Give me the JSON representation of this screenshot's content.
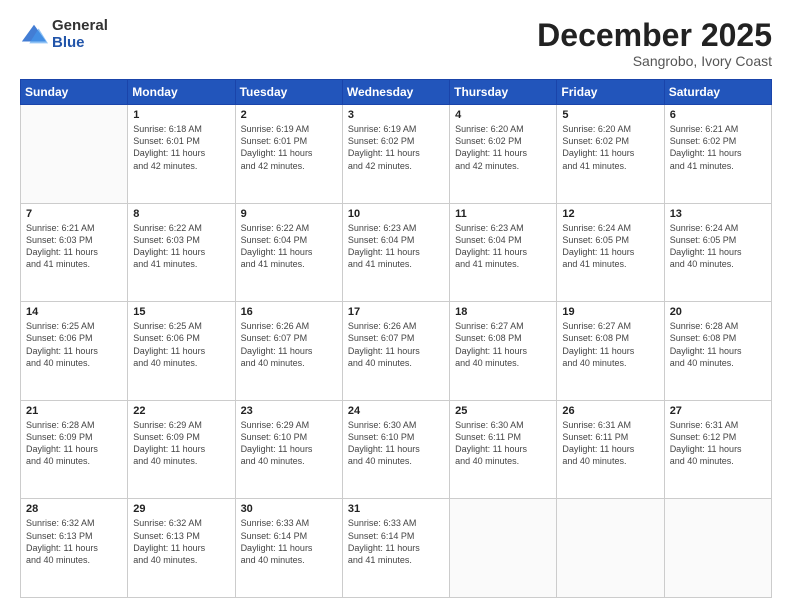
{
  "logo": {
    "general": "General",
    "blue": "Blue"
  },
  "header": {
    "month": "December 2025",
    "location": "Sangrobo, Ivory Coast"
  },
  "weekdays": [
    "Sunday",
    "Monday",
    "Tuesday",
    "Wednesday",
    "Thursday",
    "Friday",
    "Saturday"
  ],
  "weeks": [
    [
      {
        "day": "",
        "info": ""
      },
      {
        "day": "1",
        "info": "Sunrise: 6:18 AM\nSunset: 6:01 PM\nDaylight: 11 hours\nand 42 minutes."
      },
      {
        "day": "2",
        "info": "Sunrise: 6:19 AM\nSunset: 6:01 PM\nDaylight: 11 hours\nand 42 minutes."
      },
      {
        "day": "3",
        "info": "Sunrise: 6:19 AM\nSunset: 6:02 PM\nDaylight: 11 hours\nand 42 minutes."
      },
      {
        "day": "4",
        "info": "Sunrise: 6:20 AM\nSunset: 6:02 PM\nDaylight: 11 hours\nand 42 minutes."
      },
      {
        "day": "5",
        "info": "Sunrise: 6:20 AM\nSunset: 6:02 PM\nDaylight: 11 hours\nand 41 minutes."
      },
      {
        "day": "6",
        "info": "Sunrise: 6:21 AM\nSunset: 6:02 PM\nDaylight: 11 hours\nand 41 minutes."
      }
    ],
    [
      {
        "day": "7",
        "info": "Sunrise: 6:21 AM\nSunset: 6:03 PM\nDaylight: 11 hours\nand 41 minutes."
      },
      {
        "day": "8",
        "info": "Sunrise: 6:22 AM\nSunset: 6:03 PM\nDaylight: 11 hours\nand 41 minutes."
      },
      {
        "day": "9",
        "info": "Sunrise: 6:22 AM\nSunset: 6:04 PM\nDaylight: 11 hours\nand 41 minutes."
      },
      {
        "day": "10",
        "info": "Sunrise: 6:23 AM\nSunset: 6:04 PM\nDaylight: 11 hours\nand 41 minutes."
      },
      {
        "day": "11",
        "info": "Sunrise: 6:23 AM\nSunset: 6:04 PM\nDaylight: 11 hours\nand 41 minutes."
      },
      {
        "day": "12",
        "info": "Sunrise: 6:24 AM\nSunset: 6:05 PM\nDaylight: 11 hours\nand 41 minutes."
      },
      {
        "day": "13",
        "info": "Sunrise: 6:24 AM\nSunset: 6:05 PM\nDaylight: 11 hours\nand 40 minutes."
      }
    ],
    [
      {
        "day": "14",
        "info": "Sunrise: 6:25 AM\nSunset: 6:06 PM\nDaylight: 11 hours\nand 40 minutes."
      },
      {
        "day": "15",
        "info": "Sunrise: 6:25 AM\nSunset: 6:06 PM\nDaylight: 11 hours\nand 40 minutes."
      },
      {
        "day": "16",
        "info": "Sunrise: 6:26 AM\nSunset: 6:07 PM\nDaylight: 11 hours\nand 40 minutes."
      },
      {
        "day": "17",
        "info": "Sunrise: 6:26 AM\nSunset: 6:07 PM\nDaylight: 11 hours\nand 40 minutes."
      },
      {
        "day": "18",
        "info": "Sunrise: 6:27 AM\nSunset: 6:08 PM\nDaylight: 11 hours\nand 40 minutes."
      },
      {
        "day": "19",
        "info": "Sunrise: 6:27 AM\nSunset: 6:08 PM\nDaylight: 11 hours\nand 40 minutes."
      },
      {
        "day": "20",
        "info": "Sunrise: 6:28 AM\nSunset: 6:08 PM\nDaylight: 11 hours\nand 40 minutes."
      }
    ],
    [
      {
        "day": "21",
        "info": "Sunrise: 6:28 AM\nSunset: 6:09 PM\nDaylight: 11 hours\nand 40 minutes."
      },
      {
        "day": "22",
        "info": "Sunrise: 6:29 AM\nSunset: 6:09 PM\nDaylight: 11 hours\nand 40 minutes."
      },
      {
        "day": "23",
        "info": "Sunrise: 6:29 AM\nSunset: 6:10 PM\nDaylight: 11 hours\nand 40 minutes."
      },
      {
        "day": "24",
        "info": "Sunrise: 6:30 AM\nSunset: 6:10 PM\nDaylight: 11 hours\nand 40 minutes."
      },
      {
        "day": "25",
        "info": "Sunrise: 6:30 AM\nSunset: 6:11 PM\nDaylight: 11 hours\nand 40 minutes."
      },
      {
        "day": "26",
        "info": "Sunrise: 6:31 AM\nSunset: 6:11 PM\nDaylight: 11 hours\nand 40 minutes."
      },
      {
        "day": "27",
        "info": "Sunrise: 6:31 AM\nSunset: 6:12 PM\nDaylight: 11 hours\nand 40 minutes."
      }
    ],
    [
      {
        "day": "28",
        "info": "Sunrise: 6:32 AM\nSunset: 6:13 PM\nDaylight: 11 hours\nand 40 minutes."
      },
      {
        "day": "29",
        "info": "Sunrise: 6:32 AM\nSunset: 6:13 PM\nDaylight: 11 hours\nand 40 minutes."
      },
      {
        "day": "30",
        "info": "Sunrise: 6:33 AM\nSunset: 6:14 PM\nDaylight: 11 hours\nand 40 minutes."
      },
      {
        "day": "31",
        "info": "Sunrise: 6:33 AM\nSunset: 6:14 PM\nDaylight: 11 hours\nand 41 minutes."
      },
      {
        "day": "",
        "info": ""
      },
      {
        "day": "",
        "info": ""
      },
      {
        "day": "",
        "info": ""
      }
    ]
  ]
}
